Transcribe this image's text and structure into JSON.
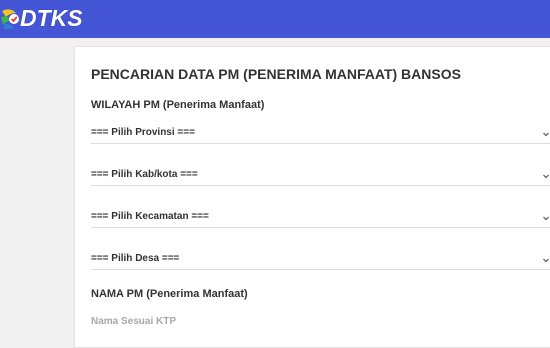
{
  "header": {
    "logo_text": "DTKS",
    "background_color": "#4455d6"
  },
  "form": {
    "title": "PENCARIAN DATA PM (PENERIMA MANFAAT) BANSOS",
    "wilayah_label": "WILAYAH PM (Penerima Manfaat)",
    "provinsi": "=== Pilih Provinsi ===",
    "kabkota": "=== Pilih Kab/kota ===",
    "kecamatan": "=== Pilih Kecamatan ===",
    "desa": "=== Pilih Desa ===",
    "nama_label": "NAMA PM (Penerima Manfaat)",
    "nama_placeholder": "Nama Sesuai KTP"
  },
  "icons": {
    "logo": "dtks-logo-icon",
    "dropdown": "chevron-down-icon"
  }
}
